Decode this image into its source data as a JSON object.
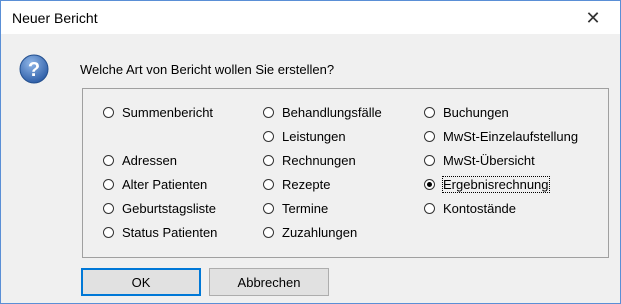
{
  "window": {
    "title": "Neuer Bericht",
    "close_glyph": "✕"
  },
  "dialog": {
    "icon": "question-icon",
    "question": "Welche Art von Bericht wollen Sie erstellen?",
    "selected": "ergebnisrechnung"
  },
  "options": {
    "summenbericht": "Summenbericht",
    "adressen": "Adressen",
    "alter_patienten": "Alter Patienten",
    "geburtstagsliste": "Geburtstagsliste",
    "status_patienten": "Status Patienten",
    "behandlungsfaelle": "Behandlungsfälle",
    "leistungen": "Leistungen",
    "rechnungen": "Rechnungen",
    "rezepte": "Rezepte",
    "termine": "Termine",
    "zuzahlungen": "Zuzahlungen",
    "buchungen": "Buchungen",
    "mwst_einzelaufstellung": "MwSt-Einzelaufstellung",
    "mwst_uebersicht": "MwSt-Übersicht",
    "ergebnisrechnung": "Ergebnisrechnung",
    "kontostaende": "Kontostände"
  },
  "buttons": {
    "ok": "OK",
    "cancel": "Abbrechen"
  },
  "colors": {
    "accent": "#0078d7",
    "icon_blue": "#3b6fb6",
    "window_border": "#5a8fd6"
  }
}
